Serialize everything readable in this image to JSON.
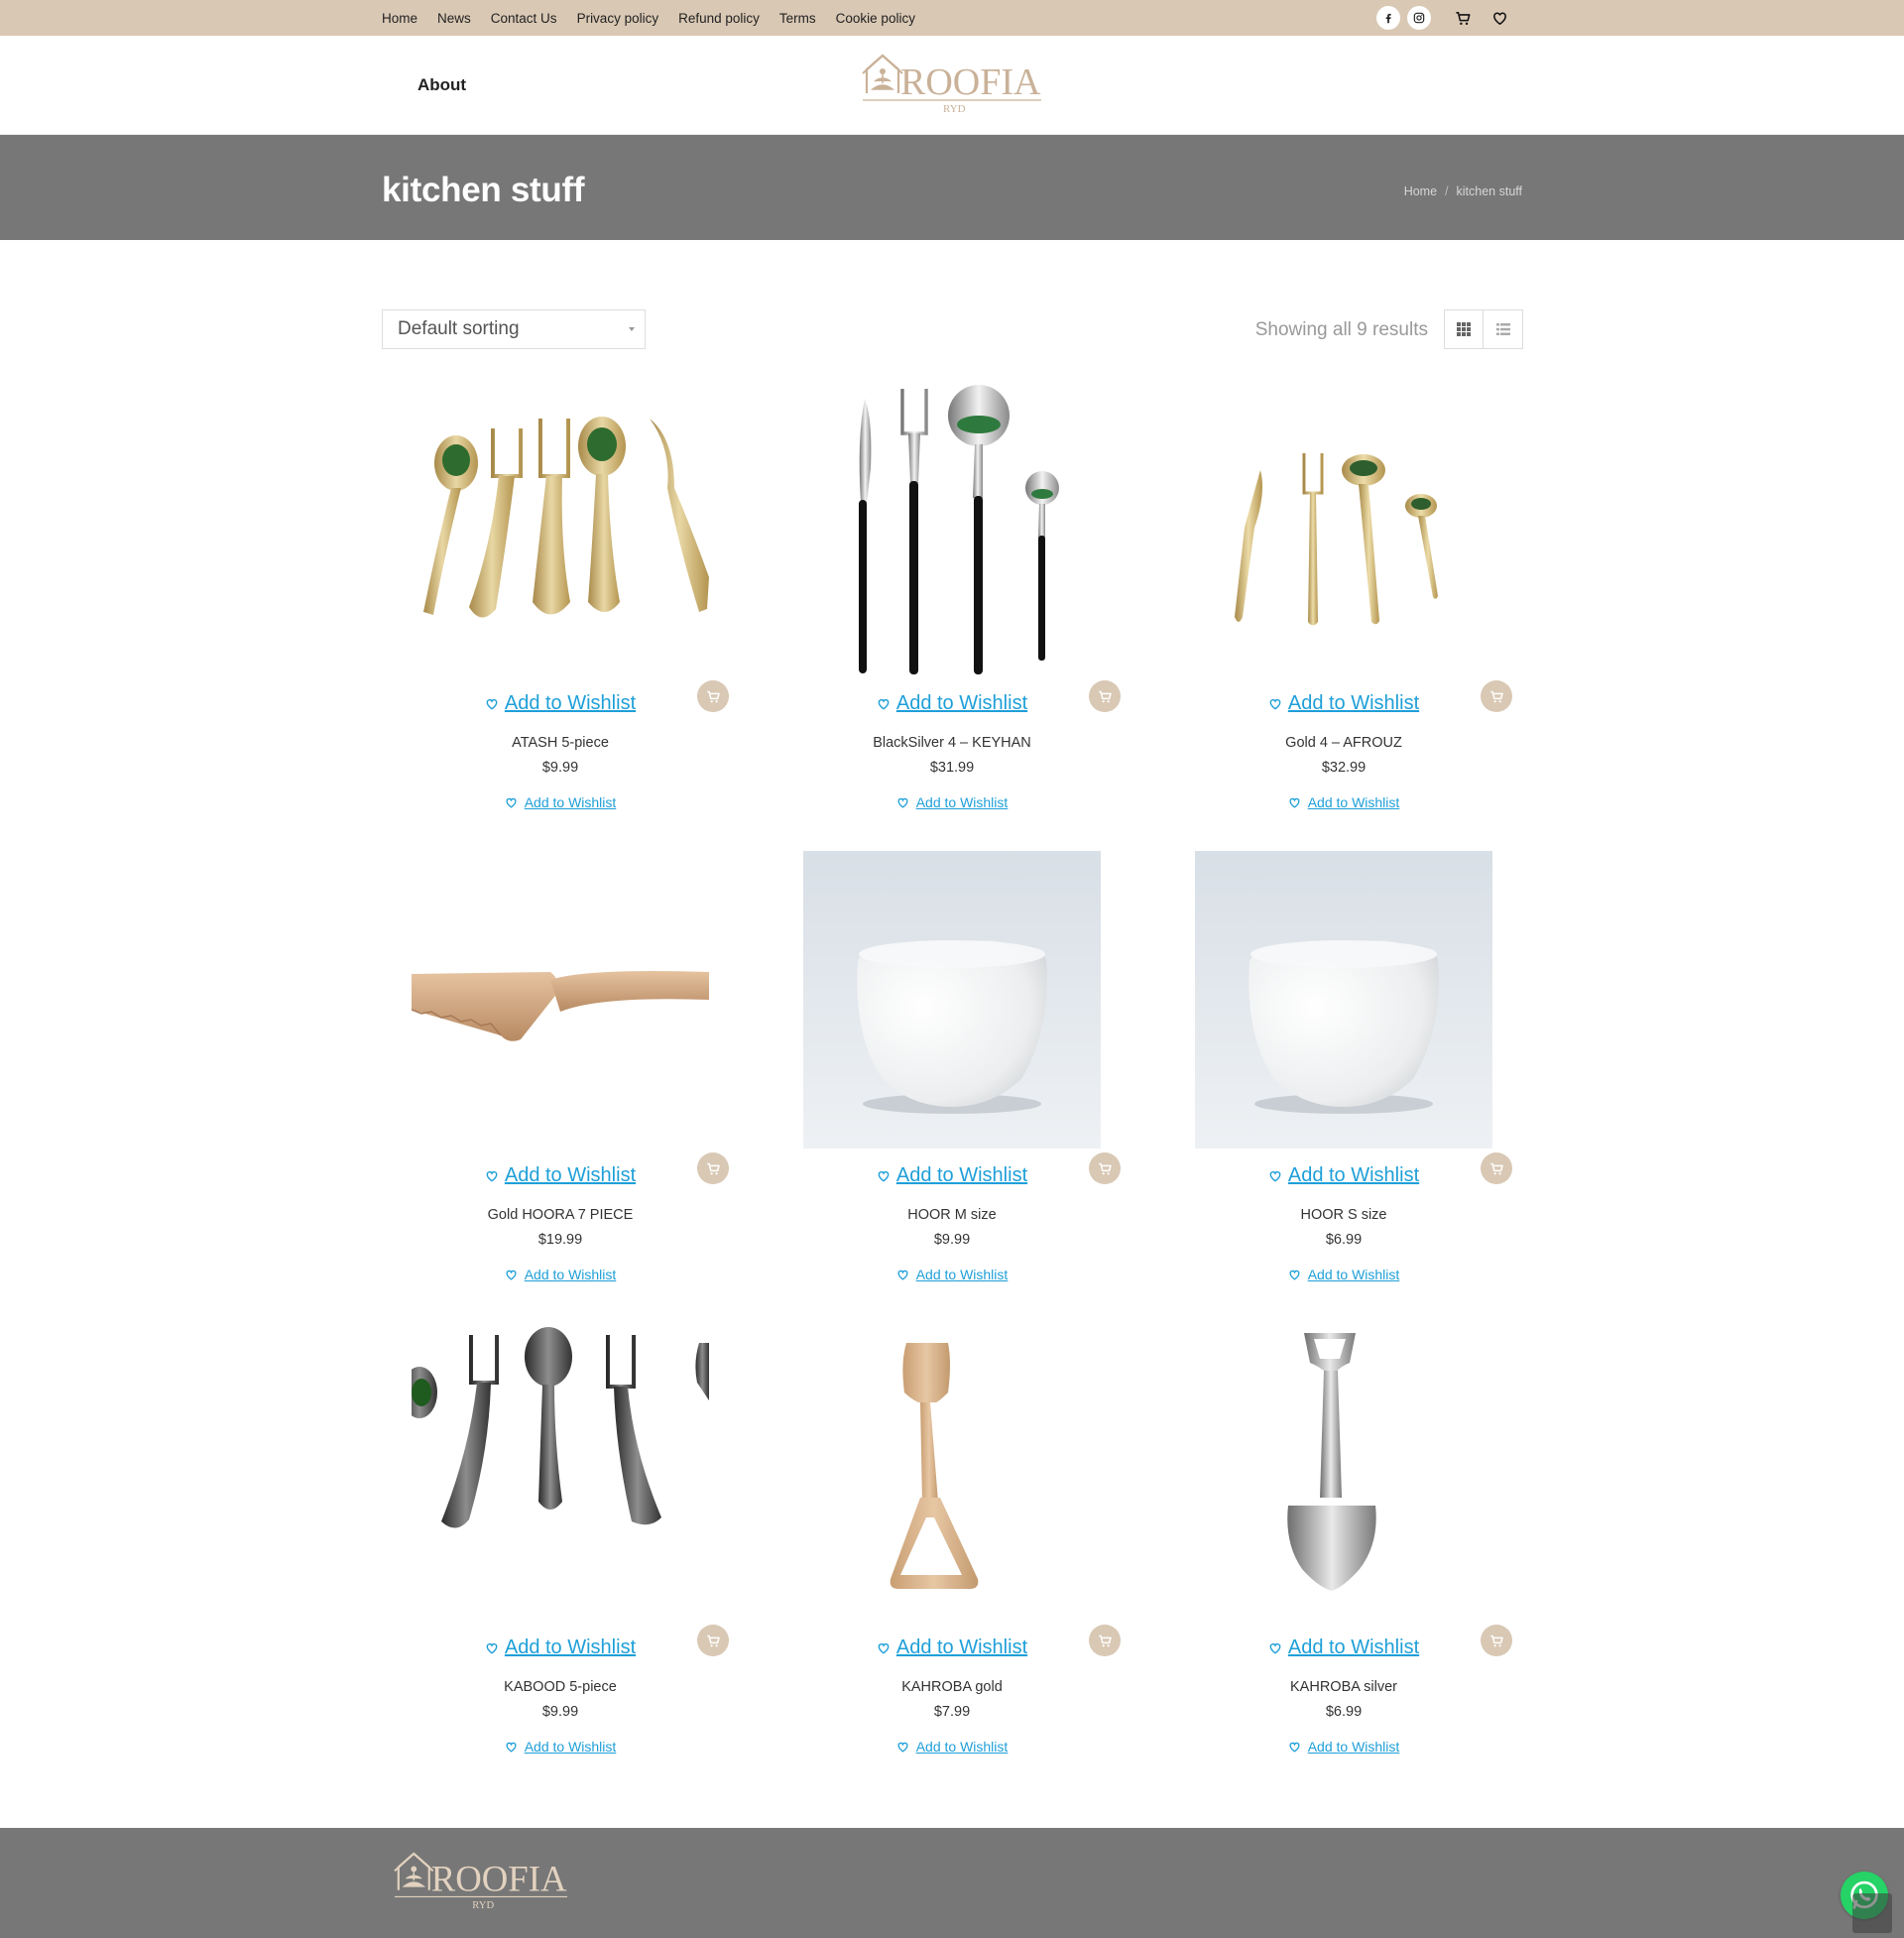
{
  "colors": {
    "topbar": "#d9c8b4",
    "titleband": "#777777",
    "accent": "#d9c8b4",
    "link": "#1e9fd8",
    "whatsapp": "#25d366"
  },
  "topbar": {
    "nav": [
      "Home",
      "News",
      "Contact Us",
      "Privacy policy",
      "Refund policy",
      "Terms",
      "Cookie policy"
    ],
    "icons": [
      "facebook-icon",
      "instagram-icon",
      "cart-icon",
      "heart-icon"
    ]
  },
  "header": {
    "menu_about": "About",
    "logo_text": "ROOFIA",
    "logo_sub": "RYD"
  },
  "page": {
    "title": "kitchen stuff",
    "breadcrumb": [
      "Home",
      "kitchen stuff"
    ]
  },
  "toolbar": {
    "sort_value": "Default sorting",
    "results_text": "Showing all 9 results",
    "view_modes": [
      "grid-view-icon",
      "list-view-icon"
    ]
  },
  "wishlist_label": "Add to Wishlist",
  "products": [
    {
      "name": "ATASH 5-piece",
      "price": "$9.99",
      "image": "gold-cutlery-set"
    },
    {
      "name": "BlackSilver 4 – KEYHAN",
      "price": "$31.99",
      "image": "black-silver-cutlery-set"
    },
    {
      "name": "Gold 4 – AFROUZ",
      "price": "$32.99",
      "image": "gold-cutlery-set-slim"
    },
    {
      "name": "Gold HOORA 7 PIECE",
      "price": "$19.99",
      "image": "cake-server"
    },
    {
      "name": "HOOR M size",
      "price": "$9.99",
      "image": "white-bowl"
    },
    {
      "name": "HOOR S size",
      "price": "$6.99",
      "image": "white-bowl"
    },
    {
      "name": "KABOOD 5-piece",
      "price": "$9.99",
      "image": "dark-cutlery-set"
    },
    {
      "name": "KAHROBA gold",
      "price": "$7.99",
      "image": "gold-shovel-spoon"
    },
    {
      "name": "KAHROBA silver",
      "price": "$6.99",
      "image": "silver-shovel-spoon"
    }
  ],
  "footer": {
    "logo_text": "ROOFIA",
    "logo_sub": "RYD"
  }
}
